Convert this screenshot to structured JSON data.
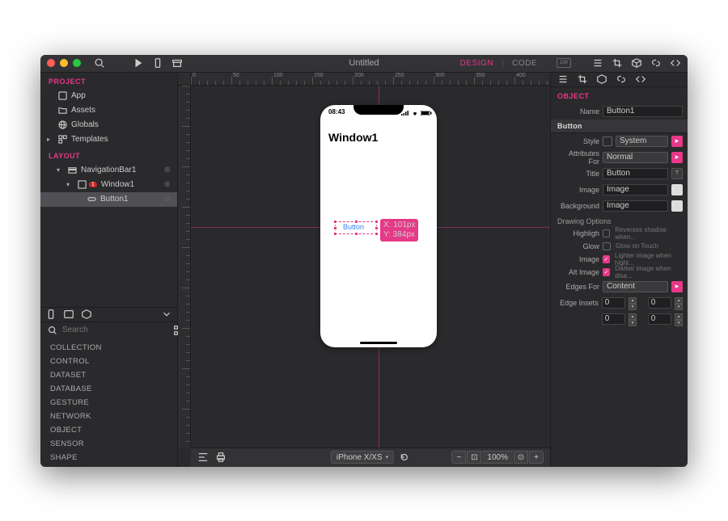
{
  "titlebar": {
    "title": "Untitled",
    "tabs": {
      "design": "DESIGN",
      "code": "CODE",
      "sep": "|"
    }
  },
  "project": {
    "head": "PROJECT",
    "items": [
      "App",
      "Assets",
      "Globals",
      "Templates"
    ]
  },
  "layout": {
    "head": "LAYOUT",
    "navbar": "NavigationBar1",
    "window": "Window1",
    "button": "Button1",
    "badge": "1"
  },
  "library": {
    "search_placeholder": "Search",
    "groups": [
      "COLLECTION",
      "CONTROL",
      "DATASET",
      "DATABASE",
      "GESTURE",
      "NETWORK",
      "OBJECT",
      "SENSOR",
      "SHAPE"
    ]
  },
  "device": {
    "name": "iPhone X/XS",
    "time": "08:43",
    "window_title": "Window1",
    "sel_label": "Button",
    "coord_x": "X: 101px",
    "coord_y": "Y: 384px"
  },
  "zoom": {
    "value": "100%"
  },
  "inspector": {
    "head": "OBJECT",
    "name_label": "Name",
    "name_value": "Button1",
    "section_button": "Button",
    "style_label": "Style",
    "style_value": "System",
    "attr_label": "Attributes For",
    "attr_value": "Normal",
    "title_label": "Title",
    "title_value": "Button",
    "image_label": "Image",
    "image_ph": "Image",
    "bg_label": "Background",
    "bg_ph": "Image",
    "draw_head": "Drawing Options",
    "opt_highlight": "Highligh",
    "opt_highlight_desc": "Reverses shadow when...",
    "opt_glow": "Glow",
    "opt_glow_desc": "Glow on Touch",
    "opt_image": "Image",
    "opt_image_desc": "Lighter image when highl...",
    "opt_alt": "Alt Image",
    "opt_alt_desc": "Darker image when disa...",
    "edges_label": "Edges For",
    "edges_value": "Content",
    "insets_label": "Edge Insets",
    "inset_vals": [
      "0",
      "0",
      "0",
      "0"
    ]
  }
}
